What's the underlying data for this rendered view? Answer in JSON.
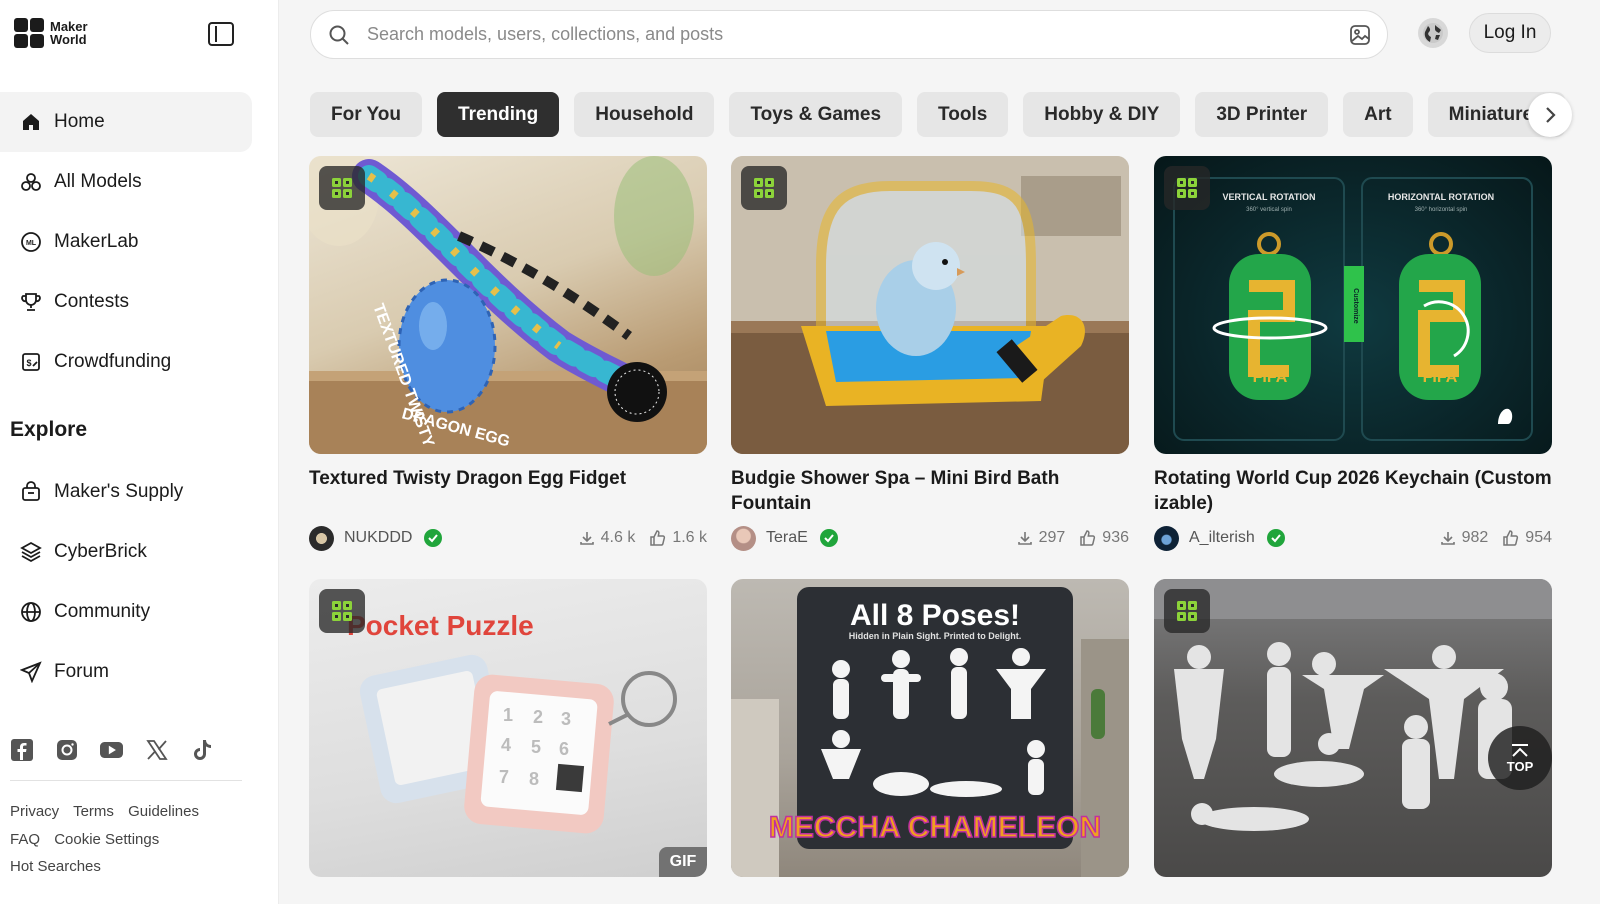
{
  "brand": {
    "line1": "Maker",
    "line2": "World"
  },
  "sidebar": {
    "nav": [
      {
        "label": "Home",
        "icon": "home-icon"
      },
      {
        "label": "All Models",
        "icon": "models-icon"
      },
      {
        "label": "MakerLab",
        "icon": "makerlab-icon"
      },
      {
        "label": "Contests",
        "icon": "trophy-icon"
      },
      {
        "label": "Crowdfunding",
        "icon": "crowdfunding-icon"
      }
    ],
    "explore_heading": "Explore",
    "explore": [
      {
        "label": "Maker's Supply",
        "icon": "shopping-bag-icon"
      },
      {
        "label": "CyberBrick",
        "icon": "cyberbrick-icon"
      },
      {
        "label": "Community",
        "icon": "globe-icon"
      },
      {
        "label": "Forum",
        "icon": "send-icon"
      }
    ],
    "footer": {
      "privacy": "Privacy",
      "terms": "Terms",
      "guidelines": "Guidelines",
      "faq": "FAQ",
      "cookies": "Cookie Settings",
      "hot": "Hot Searches"
    }
  },
  "search": {
    "placeholder": "Search models, users, collections, and posts"
  },
  "header": {
    "login": "Log In"
  },
  "tabs": [
    "For You",
    "Trending",
    "Household",
    "Toys & Games",
    "Tools",
    "Hobby & DIY",
    "3D Printer",
    "Art",
    "Miniatures"
  ],
  "cards": [
    {
      "title": "Textured Twisty Dragon Egg Fidget",
      "author": "NUKDDD",
      "downloads": "4.6 k",
      "likes": "1.6 k"
    },
    {
      "title": "Budgie Shower Spa – Mini Bird Bath Fountain",
      "author": "TeraE",
      "downloads": "297",
      "likes": "936"
    },
    {
      "title": "Rotating World Cup 2026 Keychain (Customizable)",
      "author": "A_ilterish",
      "downloads": "982",
      "likes": "954"
    },
    {
      "image_text": "Pocket Puzzle",
      "gif": "GIF"
    },
    {
      "image_text": "All 8 Poses!",
      "image_subtext": "Hidden in Plain Sight. Printed to Delight.",
      "image_brand": "MECCHA CHAMELEON"
    },
    {}
  ],
  "card3_img": {
    "left": "VERTICAL ROTATION",
    "left_sub": "360° vertical spin",
    "right": "HORIZONTAL ROTATION",
    "right_sub": "360° horizontal spin",
    "fifa": "FIFA",
    "center": "Customize"
  },
  "top_button": "TOP",
  "colors": {
    "accent_green": "#20a53b",
    "active_tab": "#2f2f2f",
    "badge_green": "#8cd33a"
  }
}
